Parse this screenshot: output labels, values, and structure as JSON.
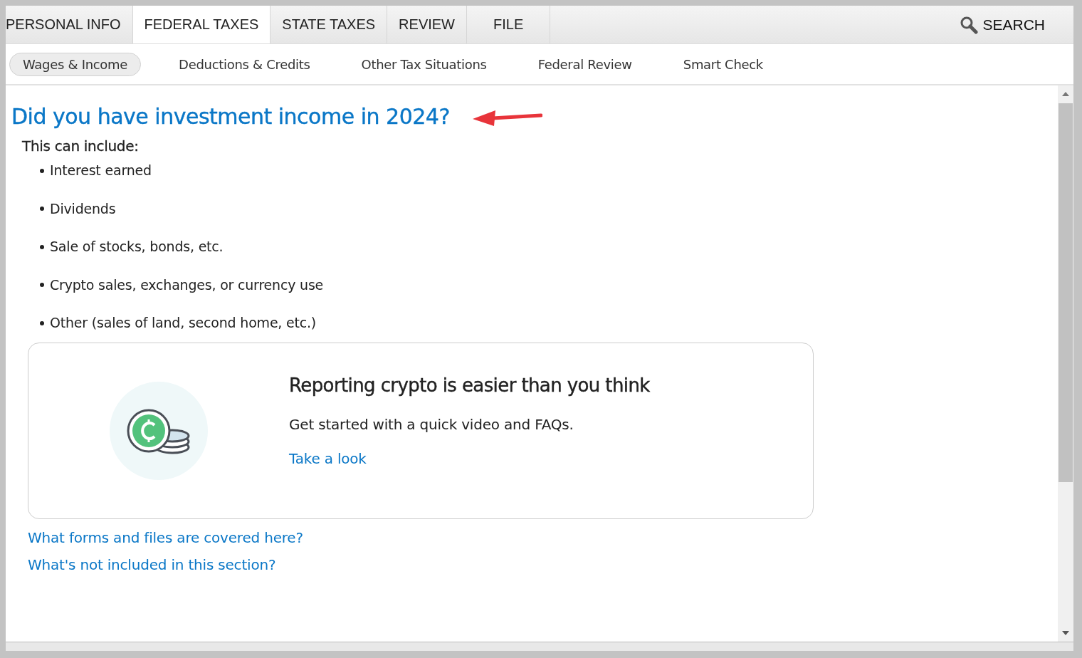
{
  "tabs": [
    {
      "label": "PERSONAL INFO",
      "selected": false
    },
    {
      "label": "FEDERAL TAXES",
      "selected": true
    },
    {
      "label": "STATE TAXES",
      "selected": false
    },
    {
      "label": "REVIEW",
      "selected": false
    },
    {
      "label": "FILE",
      "selected": false
    }
  ],
  "search": {
    "label": "SEARCH"
  },
  "subnav": [
    {
      "label": "Wages & Income",
      "selected": true
    },
    {
      "label": "Deductions & Credits",
      "selected": false
    },
    {
      "label": "Other Tax Situations",
      "selected": false
    },
    {
      "label": "Federal Review",
      "selected": false
    },
    {
      "label": "Smart Check",
      "selected": false
    }
  ],
  "heading": "Did you have investment income in 2024?",
  "intro": "This can include:",
  "items": [
    "Interest earned",
    "Dividends",
    "Sale of stocks, bonds, etc.",
    "Crypto sales, exchanges, or currency use",
    "Other (sales of land, second home, etc.)"
  ],
  "card": {
    "title": "Reporting crypto is easier than you think",
    "text": "Get started with a quick video and FAQs.",
    "link": "Take a look"
  },
  "links": [
    "What forms and files are covered here?",
    "What's not included in this section?"
  ]
}
